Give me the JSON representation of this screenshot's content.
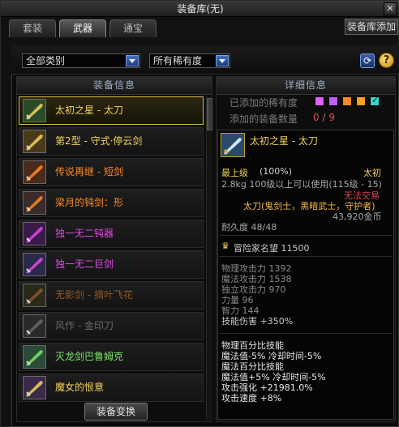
{
  "window": {
    "title": "装备库(无)"
  },
  "tabs": [
    {
      "label": "套装",
      "active": false
    },
    {
      "label": "武器",
      "active": true
    },
    {
      "label": "通宝",
      "active": false
    }
  ],
  "right_tab": {
    "label": "装备库添加"
  },
  "filters": {
    "category": "全部类别",
    "rarity": "所有稀有度"
  },
  "list_panel": {
    "header": "装备信息",
    "items": [
      {
        "name": "太初之星 - 太刀",
        "color": "#f3d25a",
        "icon": "sword-icon",
        "selected": true
      },
      {
        "name": "第2型 - 守式·停云剑",
        "color": "#f3d25a",
        "icon": "sword-icon",
        "selected": false
      },
      {
        "name": "传说再继 - 短剑",
        "color": "#ff8a1f",
        "icon": "dagger-icon",
        "selected": false
      },
      {
        "name": "梁月的钝剑：形",
        "color": "#ff8a1f",
        "icon": "blade-icon",
        "selected": false
      },
      {
        "name": "独一无二钝器",
        "color": "#e04ae8",
        "icon": "club-icon",
        "selected": false
      },
      {
        "name": "独一无二巨剑",
        "color": "#e04ae8",
        "icon": "greatsword-icon",
        "selected": false
      },
      {
        "name": "无影剑 - 摘叶飞花",
        "color": "#8a5a2a",
        "icon": "sword-icon",
        "selected": false
      },
      {
        "name": "风作 - 金印刀",
        "color": "#6a6a6a",
        "icon": "blade-icon",
        "selected": false
      },
      {
        "name": "灭龙剑巴鲁姆克",
        "color": "#7ee86a",
        "icon": "sword-icon",
        "selected": false
      },
      {
        "name": "魔女的恨意",
        "color": "#f3d25a",
        "icon": "club-icon",
        "selected": false
      }
    ],
    "swap_button": "装备变换"
  },
  "detail_panel": {
    "header": "详细信息",
    "added_rarity_label": "已添加的稀有度",
    "rarity_colors": [
      "#e060ff",
      "#c060ff",
      "#ff8a1f",
      "#ffa020",
      "#3ad6c8"
    ],
    "added_count_label": "添加的装备数量",
    "added_count_value": "0",
    "added_count_total": "9"
  },
  "tooltip": {
    "item_name": "太初之星 - 太刀",
    "grade": "最上级",
    "grade_pct": "(100%)",
    "grade_tag": "太初",
    "weight_line": "2.8kg  100级以上可以使用(115级 - 15)",
    "trade": "无法交易",
    "usable": "太刀(鬼剑士，黑暗武士，守护者)",
    "price": "43,920金币",
    "durability": "耐久度 48/48",
    "reputation": "冒险家名望 11500",
    "stats": [
      "物理攻击力 1392",
      "魔法攻击力 1538",
      "独立攻击力 970",
      "力量 96",
      "智力 144",
      "技能伤害 +350%"
    ],
    "effects": [
      "物理百分比技能",
      " 魔法值-5% 冷却时间-5%",
      "魔法百分比技能",
      " 魔法值+5% 冷却时间-5%",
      "攻击强化 +21981.0%",
      "攻击速度 +8%"
    ]
  }
}
